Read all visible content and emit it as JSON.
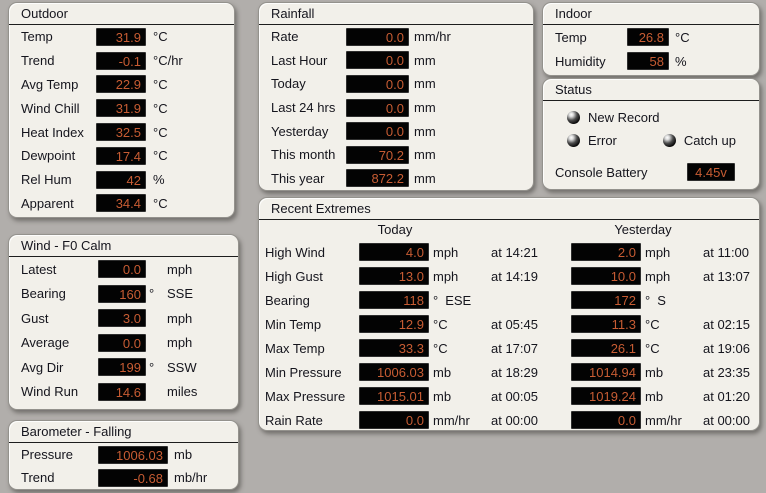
{
  "colors": {
    "desktop_background": "#b1aeab",
    "panel_background": "#f2f0ea",
    "lcd_background": "#030303",
    "lcd_text": "#c75c33",
    "label_text": "#15151d"
  },
  "panels": {
    "outdoor": {
      "title": "Outdoor",
      "rows": [
        {
          "label": "Temp",
          "value": "31.9",
          "unit": "°C"
        },
        {
          "label": "Trend",
          "value": "-0.1",
          "unit": "°C/hr"
        },
        {
          "label": "Avg Temp",
          "value": "22.9",
          "unit": "°C"
        },
        {
          "label": "Wind Chill",
          "value": "31.9",
          "unit": "°C"
        },
        {
          "label": "Heat Index",
          "value": "32.5",
          "unit": "°C"
        },
        {
          "label": "Dewpoint",
          "value": "17.4",
          "unit": "°C"
        },
        {
          "label": "Rel Hum",
          "value": "42",
          "unit": "%"
        },
        {
          "label": "Apparent",
          "value": "34.4",
          "unit": "°C"
        }
      ]
    },
    "rainfall": {
      "title": "Rainfall",
      "rows": [
        {
          "label": "Rate",
          "value": "0.0",
          "unit": "mm/hr"
        },
        {
          "label": "Last Hour",
          "value": "0.0",
          "unit": "mm"
        },
        {
          "label": "Today",
          "value": "0.0",
          "unit": "mm"
        },
        {
          "label": "Last 24 hrs",
          "value": "0.0",
          "unit": "mm"
        },
        {
          "label": "Yesterday",
          "value": "0.0",
          "unit": "mm"
        },
        {
          "label": "This month",
          "value": "70.2",
          "unit": "mm"
        },
        {
          "label": "This year",
          "value": "872.2",
          "unit": "mm"
        }
      ]
    },
    "indoor": {
      "title": "Indoor",
      "rows": [
        {
          "label": "Temp",
          "value": "26.8",
          "unit": "°C"
        },
        {
          "label": "Humidity",
          "value": "58",
          "unit": "%"
        }
      ]
    },
    "status": {
      "title": "Status",
      "leds": [
        {
          "label": "New Record"
        },
        {
          "label": "Error"
        },
        {
          "label": "Catch up"
        }
      ],
      "battery_label": "Console Battery",
      "battery_value": "4.45v"
    },
    "wind": {
      "title": "Wind - F0 Calm",
      "rows": [
        {
          "label": "Latest",
          "value": "0.0",
          "deg": "",
          "unit": "mph"
        },
        {
          "label": "Bearing",
          "value": "160",
          "deg": "°",
          "unit": "SSE"
        },
        {
          "label": "Gust",
          "value": "3.0",
          "deg": "",
          "unit": "mph"
        },
        {
          "label": "Average",
          "value": "0.0",
          "deg": "",
          "unit": "mph"
        },
        {
          "label": "Avg Dir",
          "value": "199",
          "deg": "°",
          "unit": "SSW"
        },
        {
          "label": "Wind Run",
          "value": "14.6",
          "deg": "",
          "unit": "miles"
        }
      ]
    },
    "barometer": {
      "title": "Barometer - Falling",
      "rows": [
        {
          "label": "Pressure",
          "value": "1006.03",
          "unit": "mb"
        },
        {
          "label": "Trend",
          "value": "-0.68",
          "unit": "mb/hr"
        }
      ]
    },
    "extremes": {
      "title": "Recent Extremes",
      "col_today": "Today",
      "col_yesterday": "Yesterday",
      "rows": [
        {
          "label": "High Wind",
          "today": {
            "value": "4.0",
            "unit": "mph",
            "at": "at 14:21"
          },
          "yesterday": {
            "value": "2.0",
            "unit": "mph",
            "at": "at 11:00"
          }
        },
        {
          "label": "High Gust",
          "today": {
            "value": "13.0",
            "unit": "mph",
            "at": "at 14:19"
          },
          "yesterday": {
            "value": "10.0",
            "unit": "mph",
            "at": "at 13:07"
          }
        },
        {
          "label": "Bearing",
          "today": {
            "value": "118",
            "unit": "°",
            "dir": "ESE",
            "at": ""
          },
          "yesterday": {
            "value": "172",
            "unit": "°",
            "dir": "S",
            "at": ""
          }
        },
        {
          "label": "Min Temp",
          "today": {
            "value": "12.9",
            "unit": "°C",
            "at": "at 05:45"
          },
          "yesterday": {
            "value": "11.3",
            "unit": "°C",
            "at": "at 02:15"
          }
        },
        {
          "label": "Max Temp",
          "today": {
            "value": "33.3",
            "unit": "°C",
            "at": "at 17:07"
          },
          "yesterday": {
            "value": "26.1",
            "unit": "°C",
            "at": "at 19:06"
          }
        },
        {
          "label": "Min Pressure",
          "today": {
            "value": "1006.03",
            "unit": "mb",
            "at": "at 18:29"
          },
          "yesterday": {
            "value": "1014.94",
            "unit": "mb",
            "at": "at 23:35"
          }
        },
        {
          "label": "Max Pressure",
          "today": {
            "value": "1015.01",
            "unit": "mb",
            "at": "at 00:05"
          },
          "yesterday": {
            "value": "1019.24",
            "unit": "mb",
            "at": "at 01:20"
          }
        },
        {
          "label": "Rain Rate",
          "today": {
            "value": "0.0",
            "unit": "mm/hr",
            "at": "at 00:00"
          },
          "yesterday": {
            "value": "0.0",
            "unit": "mm/hr",
            "at": "at 00:00"
          }
        }
      ]
    }
  }
}
